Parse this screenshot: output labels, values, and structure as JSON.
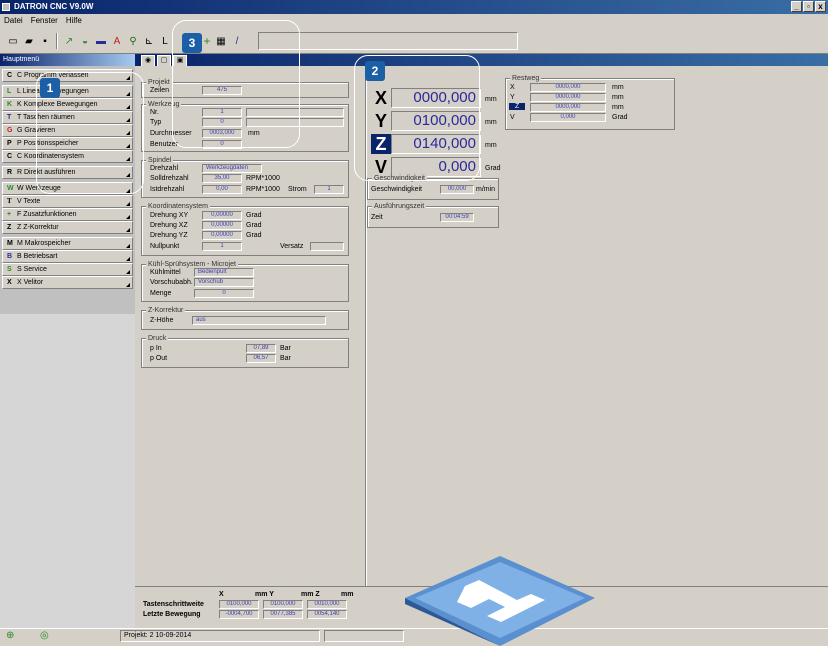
{
  "window": {
    "title": "DATRON CNC V9.0W"
  },
  "menu": [
    "Datei",
    "Fenster",
    "Hilfe"
  ],
  "sidebar": {
    "header": "Hauptmenü",
    "items": [
      {
        "icon": "C",
        "label": "C Programm verlassen"
      },
      {
        "icon": "L",
        "label": "L Lineare Bewegungen"
      },
      {
        "icon": "K",
        "label": "K Komplexe Bewegungen"
      },
      {
        "icon": "T",
        "label": "T Taschen räumen"
      },
      {
        "icon": "G",
        "label": "G Gravieren"
      },
      {
        "icon": "P",
        "label": "P Positionsspeicher"
      },
      {
        "icon": "C",
        "label": "C Koordinatensystem"
      },
      {
        "icon": "R",
        "label": "R Direkt ausführen"
      },
      {
        "icon": "W",
        "label": "W Werkzeuge"
      },
      {
        "icon": "T",
        "label": "V Texte"
      },
      {
        "icon": "+",
        "label": "F Zusatzfunktionen"
      },
      {
        "icon": "Z",
        "label": "Z Z-Korrektur"
      },
      {
        "icon": "M",
        "label": "M Makrospeicher"
      },
      {
        "icon": "B",
        "label": "B Betriebsart"
      },
      {
        "icon": "S",
        "label": "S Service"
      },
      {
        "icon": "X",
        "label": "X Velitor"
      }
    ]
  },
  "projekt": {
    "title": "Projekt",
    "zeilen_label": "Zeilen",
    "zeilen": "475"
  },
  "werkzeug": {
    "title": "Werkzeug",
    "nr_label": "Nr.",
    "nr": "1",
    "typ_label": "Typ",
    "typ": "0",
    "durchmesser_label": "Durchmesser",
    "durchmesser": "0003,000",
    "durchmesser_unit": "mm",
    "benutzer_label": "Benutzer",
    "benutzer": "0"
  },
  "spindel": {
    "title": "Spindel",
    "drehzahl_label": "Drehzahl",
    "drehzahl": "Werkzeugdaten",
    "soll_label": "Solldrehzahl",
    "soll": "35,00",
    "soll_unit": "RPM*1000",
    "ist_label": "Istdrehzahl",
    "ist": "0,00",
    "ist_unit": "RPM*1000",
    "strom_label": "Strom",
    "strom": "1"
  },
  "koordinaten": {
    "title": "Koordinatensystem",
    "xy_label": "Drehung XY",
    "xy": "0,00000",
    "xz_label": "Drehung XZ",
    "xz": "0,00000",
    "yz_label": "Drehung YZ",
    "yz": "0,00000",
    "unit": "Grad",
    "null_label": "Nullpunkt",
    "null": "1",
    "versatz_label": "Versatz"
  },
  "kuehl": {
    "title": "Kühl-Sprühsystem - Microjet",
    "mittel_label": "Kühlmittel",
    "mittel": "Bedienpult",
    "vorschub_label": "Vorschubabh.",
    "vorschub": "Vorschub",
    "menge_label": "Menge",
    "menge": "0"
  },
  "zkorr": {
    "title": "Z-Korrektur",
    "hoehe_label": "Z-Höhe",
    "hoehe": "aus"
  },
  "druck": {
    "title": "Druck",
    "pin_label": "p In",
    "pin": "07,89",
    "pout_label": "p Out",
    "pout": "06,57",
    "unit": "Bar"
  },
  "position": {
    "axes": [
      {
        "axis": "X",
        "value": "0000,000",
        "unit": "mm"
      },
      {
        "axis": "Y",
        "value": "0100,000",
        "unit": "mm"
      },
      {
        "axis": "Z",
        "value": "0140,000",
        "unit": "mm"
      },
      {
        "axis": "V",
        "value": "0,000",
        "unit": "Grad"
      }
    ]
  },
  "restweg": {
    "title": "Restweg",
    "rows": [
      {
        "axis": "X",
        "value": "0000,000",
        "unit": "mm"
      },
      {
        "axis": "Y",
        "value": "0000,000",
        "unit": "mm"
      },
      {
        "axis": "Z",
        "value": "0000,000",
        "unit": "mm"
      },
      {
        "axis": "V",
        "value": "0,000",
        "unit": "Grad"
      }
    ]
  },
  "geschw": {
    "title": "Geschwindigkeit",
    "label": "Geschwindigkeit",
    "value": "00,000",
    "unit": "m/min"
  },
  "zeit": {
    "title": "Ausführungszeit",
    "label": "Zeit",
    "value": "00:04:59"
  },
  "bottom": {
    "x_label": "X",
    "y_label": "mm Y",
    "z_label": "mm Z",
    "mm_label": "mm",
    "tasten_label": "Tastenschrittweite",
    "tasten": [
      "0100,000",
      "0100,000",
      "0010,000"
    ],
    "letzte_label": "Letzte Bewegung",
    "letzte": [
      "-0004,700",
      "0077,385",
      "0054,140"
    ]
  },
  "status": {
    "text": "Projekt: 2   10-09-2014"
  },
  "callouts": [
    "1",
    "2",
    "3"
  ],
  "colors": {
    "accent": "#0a246a",
    "badge": "#1b5fa6",
    "field_text": "#3b3bb0"
  }
}
